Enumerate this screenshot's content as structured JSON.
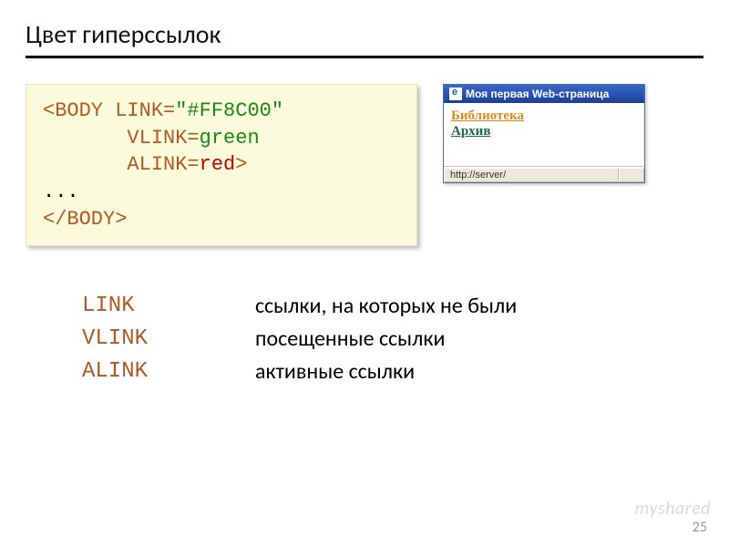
{
  "title": "Цвет гиперссылок",
  "code": {
    "l1a": "<BODY ",
    "l1b": "LINK=",
    "l1c": "\"#FF8C00\"",
    "l2a": "       VLINK=",
    "l2b": "green",
    "l3a": "       ALINK=",
    "l3b": "red",
    "l3c": ">",
    "l4": "...",
    "l5": "</BODY>"
  },
  "preview": {
    "titlebar": "Моя первая Web-страница",
    "link1": "Библиотека",
    "link2": "Архив",
    "status": "http://server/"
  },
  "defs": [
    {
      "term": "LINK",
      "desc": "ссылки, на которых не были"
    },
    {
      "term": "VLINK",
      "desc": "посещенные ссылки"
    },
    {
      "term": "ALINK",
      "desc": "активные ссылки"
    }
  ],
  "pagenum": "25",
  "watermark": "myshared"
}
